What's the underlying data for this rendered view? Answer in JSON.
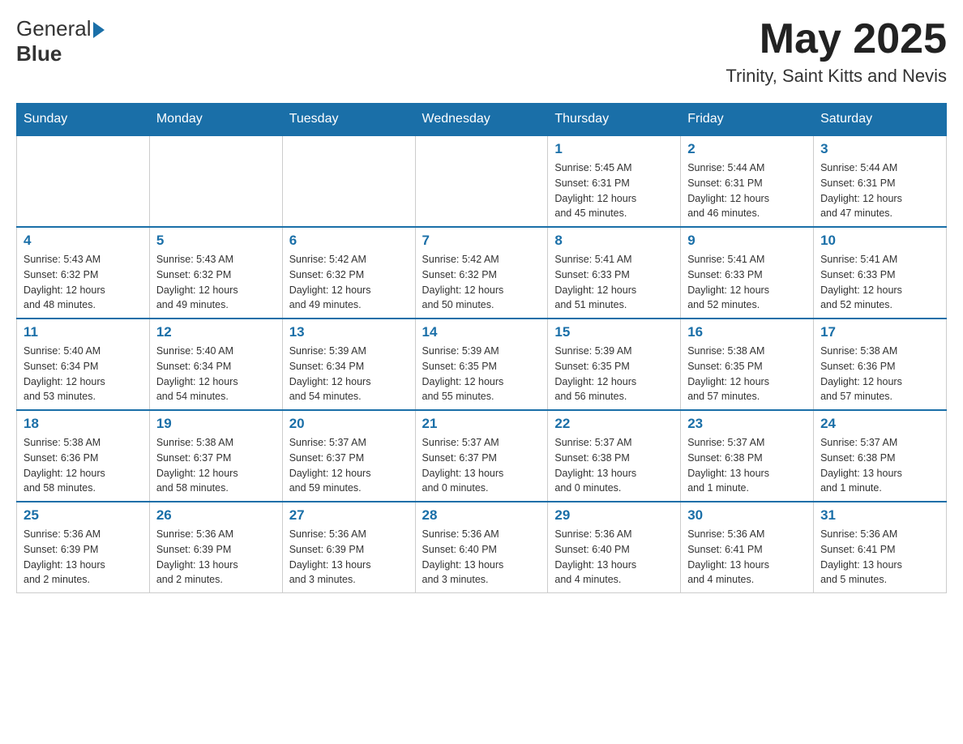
{
  "header": {
    "logo_general": "General",
    "logo_blue": "Blue",
    "month_title": "May 2025",
    "location": "Trinity, Saint Kitts and Nevis"
  },
  "days_of_week": [
    "Sunday",
    "Monday",
    "Tuesday",
    "Wednesday",
    "Thursday",
    "Friday",
    "Saturday"
  ],
  "weeks": [
    [
      {
        "day": "",
        "info": ""
      },
      {
        "day": "",
        "info": ""
      },
      {
        "day": "",
        "info": ""
      },
      {
        "day": "",
        "info": ""
      },
      {
        "day": "1",
        "info": "Sunrise: 5:45 AM\nSunset: 6:31 PM\nDaylight: 12 hours\nand 45 minutes."
      },
      {
        "day": "2",
        "info": "Sunrise: 5:44 AM\nSunset: 6:31 PM\nDaylight: 12 hours\nand 46 minutes."
      },
      {
        "day": "3",
        "info": "Sunrise: 5:44 AM\nSunset: 6:31 PM\nDaylight: 12 hours\nand 47 minutes."
      }
    ],
    [
      {
        "day": "4",
        "info": "Sunrise: 5:43 AM\nSunset: 6:32 PM\nDaylight: 12 hours\nand 48 minutes."
      },
      {
        "day": "5",
        "info": "Sunrise: 5:43 AM\nSunset: 6:32 PM\nDaylight: 12 hours\nand 49 minutes."
      },
      {
        "day": "6",
        "info": "Sunrise: 5:42 AM\nSunset: 6:32 PM\nDaylight: 12 hours\nand 49 minutes."
      },
      {
        "day": "7",
        "info": "Sunrise: 5:42 AM\nSunset: 6:32 PM\nDaylight: 12 hours\nand 50 minutes."
      },
      {
        "day": "8",
        "info": "Sunrise: 5:41 AM\nSunset: 6:33 PM\nDaylight: 12 hours\nand 51 minutes."
      },
      {
        "day": "9",
        "info": "Sunrise: 5:41 AM\nSunset: 6:33 PM\nDaylight: 12 hours\nand 52 minutes."
      },
      {
        "day": "10",
        "info": "Sunrise: 5:41 AM\nSunset: 6:33 PM\nDaylight: 12 hours\nand 52 minutes."
      }
    ],
    [
      {
        "day": "11",
        "info": "Sunrise: 5:40 AM\nSunset: 6:34 PM\nDaylight: 12 hours\nand 53 minutes."
      },
      {
        "day": "12",
        "info": "Sunrise: 5:40 AM\nSunset: 6:34 PM\nDaylight: 12 hours\nand 54 minutes."
      },
      {
        "day": "13",
        "info": "Sunrise: 5:39 AM\nSunset: 6:34 PM\nDaylight: 12 hours\nand 54 minutes."
      },
      {
        "day": "14",
        "info": "Sunrise: 5:39 AM\nSunset: 6:35 PM\nDaylight: 12 hours\nand 55 minutes."
      },
      {
        "day": "15",
        "info": "Sunrise: 5:39 AM\nSunset: 6:35 PM\nDaylight: 12 hours\nand 56 minutes."
      },
      {
        "day": "16",
        "info": "Sunrise: 5:38 AM\nSunset: 6:35 PM\nDaylight: 12 hours\nand 57 minutes."
      },
      {
        "day": "17",
        "info": "Sunrise: 5:38 AM\nSunset: 6:36 PM\nDaylight: 12 hours\nand 57 minutes."
      }
    ],
    [
      {
        "day": "18",
        "info": "Sunrise: 5:38 AM\nSunset: 6:36 PM\nDaylight: 12 hours\nand 58 minutes."
      },
      {
        "day": "19",
        "info": "Sunrise: 5:38 AM\nSunset: 6:37 PM\nDaylight: 12 hours\nand 58 minutes."
      },
      {
        "day": "20",
        "info": "Sunrise: 5:37 AM\nSunset: 6:37 PM\nDaylight: 12 hours\nand 59 minutes."
      },
      {
        "day": "21",
        "info": "Sunrise: 5:37 AM\nSunset: 6:37 PM\nDaylight: 13 hours\nand 0 minutes."
      },
      {
        "day": "22",
        "info": "Sunrise: 5:37 AM\nSunset: 6:38 PM\nDaylight: 13 hours\nand 0 minutes."
      },
      {
        "day": "23",
        "info": "Sunrise: 5:37 AM\nSunset: 6:38 PM\nDaylight: 13 hours\nand 1 minute."
      },
      {
        "day": "24",
        "info": "Sunrise: 5:37 AM\nSunset: 6:38 PM\nDaylight: 13 hours\nand 1 minute."
      }
    ],
    [
      {
        "day": "25",
        "info": "Sunrise: 5:36 AM\nSunset: 6:39 PM\nDaylight: 13 hours\nand 2 minutes."
      },
      {
        "day": "26",
        "info": "Sunrise: 5:36 AM\nSunset: 6:39 PM\nDaylight: 13 hours\nand 2 minutes."
      },
      {
        "day": "27",
        "info": "Sunrise: 5:36 AM\nSunset: 6:39 PM\nDaylight: 13 hours\nand 3 minutes."
      },
      {
        "day": "28",
        "info": "Sunrise: 5:36 AM\nSunset: 6:40 PM\nDaylight: 13 hours\nand 3 minutes."
      },
      {
        "day": "29",
        "info": "Sunrise: 5:36 AM\nSunset: 6:40 PM\nDaylight: 13 hours\nand 4 minutes."
      },
      {
        "day": "30",
        "info": "Sunrise: 5:36 AM\nSunset: 6:41 PM\nDaylight: 13 hours\nand 4 minutes."
      },
      {
        "day": "31",
        "info": "Sunrise: 5:36 AM\nSunset: 6:41 PM\nDaylight: 13 hours\nand 5 minutes."
      }
    ]
  ]
}
